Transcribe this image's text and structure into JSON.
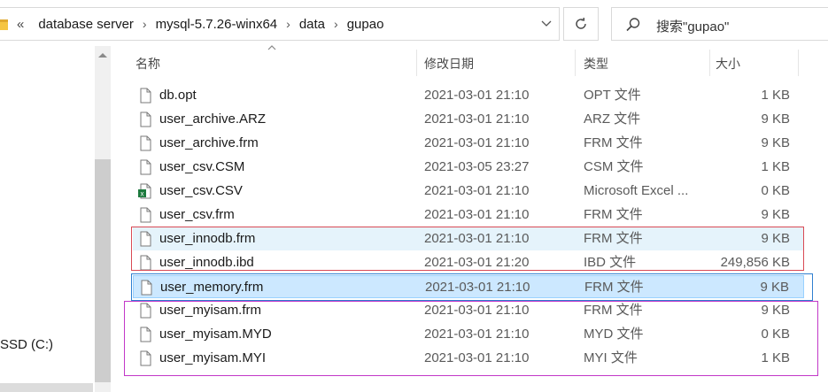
{
  "address_bar": {
    "overflow_glyph": "«",
    "breadcrumbs": [
      {
        "label": "database server"
      },
      {
        "label": "mysql-5.7.26-winx64"
      },
      {
        "label": "data"
      },
      {
        "label": "gupao"
      }
    ],
    "separator": "›"
  },
  "search": {
    "placeholder": "搜索\"gupao\""
  },
  "nav_pane": {
    "drive_label": "SSD (C:)"
  },
  "columns": {
    "name": "名称",
    "modified": "修改日期",
    "type": "类型",
    "size": "大小"
  },
  "files": [
    {
      "name": "db.opt",
      "modified": "2021-03-01 21:10",
      "type": "OPT 文件",
      "size": "1 KB",
      "icon": "file-icon",
      "state": "normal"
    },
    {
      "name": "user_archive.ARZ",
      "modified": "2021-03-01 21:10",
      "type": "ARZ 文件",
      "size": "9 KB",
      "icon": "file-icon",
      "state": "normal"
    },
    {
      "name": "user_archive.frm",
      "modified": "2021-03-01 21:10",
      "type": "FRM 文件",
      "size": "9 KB",
      "icon": "file-icon",
      "state": "normal"
    },
    {
      "name": "user_csv.CSM",
      "modified": "2021-03-05 23:27",
      "type": "CSM 文件",
      "size": "1 KB",
      "icon": "file-icon",
      "state": "normal"
    },
    {
      "name": "user_csv.CSV",
      "modified": "2021-03-01 21:10",
      "type": "Microsoft Excel ...",
      "size": "0 KB",
      "icon": "excel-file-icon",
      "state": "normal"
    },
    {
      "name": "user_csv.frm",
      "modified": "2021-03-01 21:10",
      "type": "FRM 文件",
      "size": "9 KB",
      "icon": "file-icon",
      "state": "normal"
    },
    {
      "name": "user_innodb.frm",
      "modified": "2021-03-01 21:10",
      "type": "FRM 文件",
      "size": "9 KB",
      "icon": "file-icon",
      "state": "hover"
    },
    {
      "name": "user_innodb.ibd",
      "modified": "2021-03-01 21:20",
      "type": "IBD 文件",
      "size": "249,856 KB",
      "icon": "file-icon",
      "state": "normal"
    },
    {
      "name": "user_memory.frm",
      "modified": "2021-03-01 21:10",
      "type": "FRM 文件",
      "size": "9 KB",
      "icon": "file-icon",
      "state": "selected"
    },
    {
      "name": "user_myisam.frm",
      "modified": "2021-03-01 21:10",
      "type": "FRM 文件",
      "size": "9 KB",
      "icon": "file-icon",
      "state": "normal"
    },
    {
      "name": "user_myisam.MYD",
      "modified": "2021-03-01 21:10",
      "type": "MYD 文件",
      "size": "0 KB",
      "icon": "file-icon",
      "state": "normal"
    },
    {
      "name": "user_myisam.MYI",
      "modified": "2021-03-01 21:10",
      "type": "MYI 文件",
      "size": "1 KB",
      "icon": "file-icon",
      "state": "normal"
    }
  ],
  "annotation_colors": {
    "innodb_group": "#d94a55",
    "memory_group": "#2f7fd0",
    "myisam_group": "#c238c8"
  }
}
